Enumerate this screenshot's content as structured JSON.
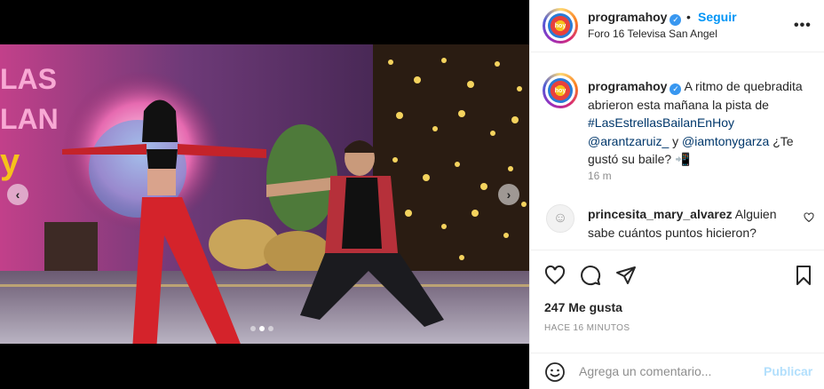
{
  "post": {
    "username": "programahoy",
    "follow_separator": "•",
    "follow_label": "Seguir",
    "location": "Foro 16 Televisa San Angel",
    "more_icon": "more-horizontal-icon",
    "avatar_text": "hoy"
  },
  "caption": {
    "username": "programahoy",
    "text_1": "A ritmo de quebradita abrieron esta mañana la pista de",
    "hashtag": "#LasEstrellasBailanEnHoy",
    "mention_1": "@arantzaruiz_",
    "connector": "y",
    "mention_2": "@iamtonygarza",
    "text_2": "¿Te gustó su baile?",
    "emoji": "📲",
    "time": "16 m"
  },
  "comment": {
    "username": "princesita_mary_alvarez",
    "text": "Alguien sabe cuántos puntos hicieron?",
    "avatar_icon": "user-avatar-icon",
    "like_icon": "heart-icon"
  },
  "actions": {
    "likes": "247 Me gusta",
    "time_ago": "HACE 16 MINUTOS",
    "icons": [
      "heart-icon",
      "comment-icon",
      "share-icon",
      "bookmark-icon"
    ]
  },
  "add_comment": {
    "placeholder": "Agrega un comentario...",
    "publish_label": "Publicar",
    "emoji_icon": "emoji-icon"
  },
  "carousel": {
    "total_slides": 3,
    "active_slide": 2,
    "prev_icon": "chevron-left-icon",
    "next_icon": "chevron-right-icon",
    "prev_glyph": "‹",
    "next_glyph": "›"
  },
  "colors": {
    "link": "#00376b",
    "follow": "#0095f6",
    "verified": "#3897f0",
    "publish_disabled": "#b2dffc",
    "muted": "#8e8e8e"
  }
}
